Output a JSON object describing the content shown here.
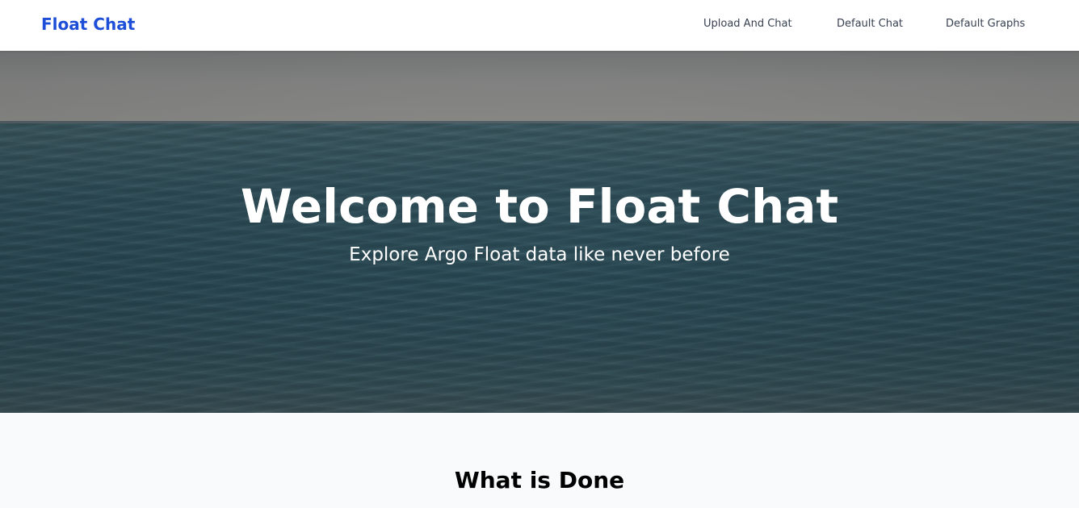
{
  "navbar": {
    "brand": "Float Chat",
    "links": [
      {
        "label": "Upload And Chat"
      },
      {
        "label": "Default Chat"
      },
      {
        "label": "Default Graphs"
      }
    ]
  },
  "hero": {
    "title": "Welcome to Float Chat",
    "subtitle": "Explore Argo Float data like never before"
  },
  "section": {
    "title": "What is Done"
  },
  "colors": {
    "brand": "#1d4ed8",
    "nav_text": "#374151",
    "section_bg": "#f9fafb"
  }
}
